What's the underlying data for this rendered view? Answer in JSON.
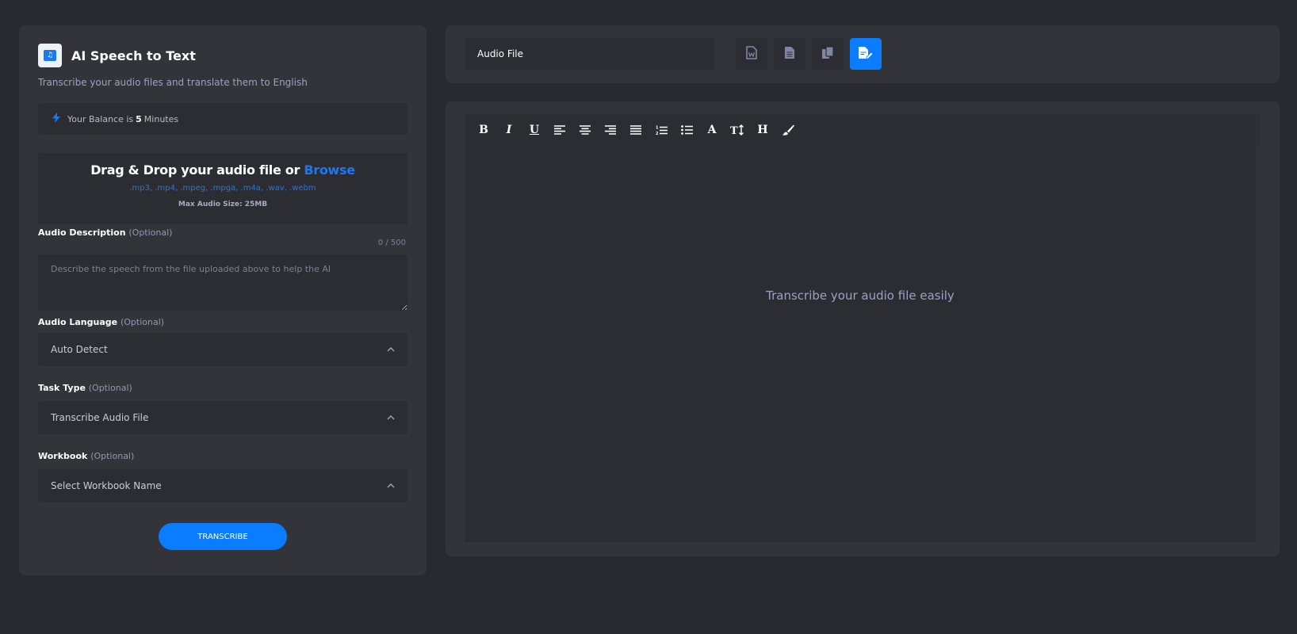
{
  "app": {
    "title": "AI Speech to Text",
    "subtitle": "Transcribe your audio files and translate them to English",
    "logo_icon": "music-file-icon"
  },
  "balance": {
    "prefix": "Your Balance is",
    "value": "5",
    "unit": "Minutes",
    "icon": "bolt-icon"
  },
  "dropzone": {
    "title": "Drag & Drop your audio file or",
    "browse": "Browse",
    "types": ".mp3, .mp4, .mpeg, .mpga, .m4a, .wav, .webm",
    "max_size": "Max Audio Size: 25MB"
  },
  "form": {
    "description": {
      "label": "Audio Description",
      "optional": "(Optional)",
      "count": "0 / 500",
      "placeholder": "Describe the speech from the file uploaded above to help the AI"
    },
    "language": {
      "label": "Audio Language",
      "optional": "(Optional)",
      "value": "Auto Detect"
    },
    "task_type": {
      "label": "Task Type",
      "optional": "(Optional)",
      "value": "Transcribe Audio File"
    },
    "workbook": {
      "label": "Workbook",
      "optional": "(Optional)",
      "value": "Select Workbook Name"
    },
    "submit_label": "TRANSCRIBE"
  },
  "top": {
    "filename": "Audio File",
    "buttons": [
      "word-export-icon",
      "text-export-icon",
      "copy-icon",
      "save-edit-icon"
    ]
  },
  "editor": {
    "placeholder": "Transcribe your audio file easily",
    "toolbar": [
      "bold",
      "italic",
      "underline",
      "align-left",
      "align-center",
      "align-right",
      "align-justify",
      "ordered-list",
      "bullet-list",
      "font-color",
      "font-size",
      "heading",
      "format-brush"
    ]
  },
  "colors": {
    "accent": "#0a7cff",
    "background": "#292a2f",
    "panel": "#33343a",
    "field": "#2c2d32"
  }
}
